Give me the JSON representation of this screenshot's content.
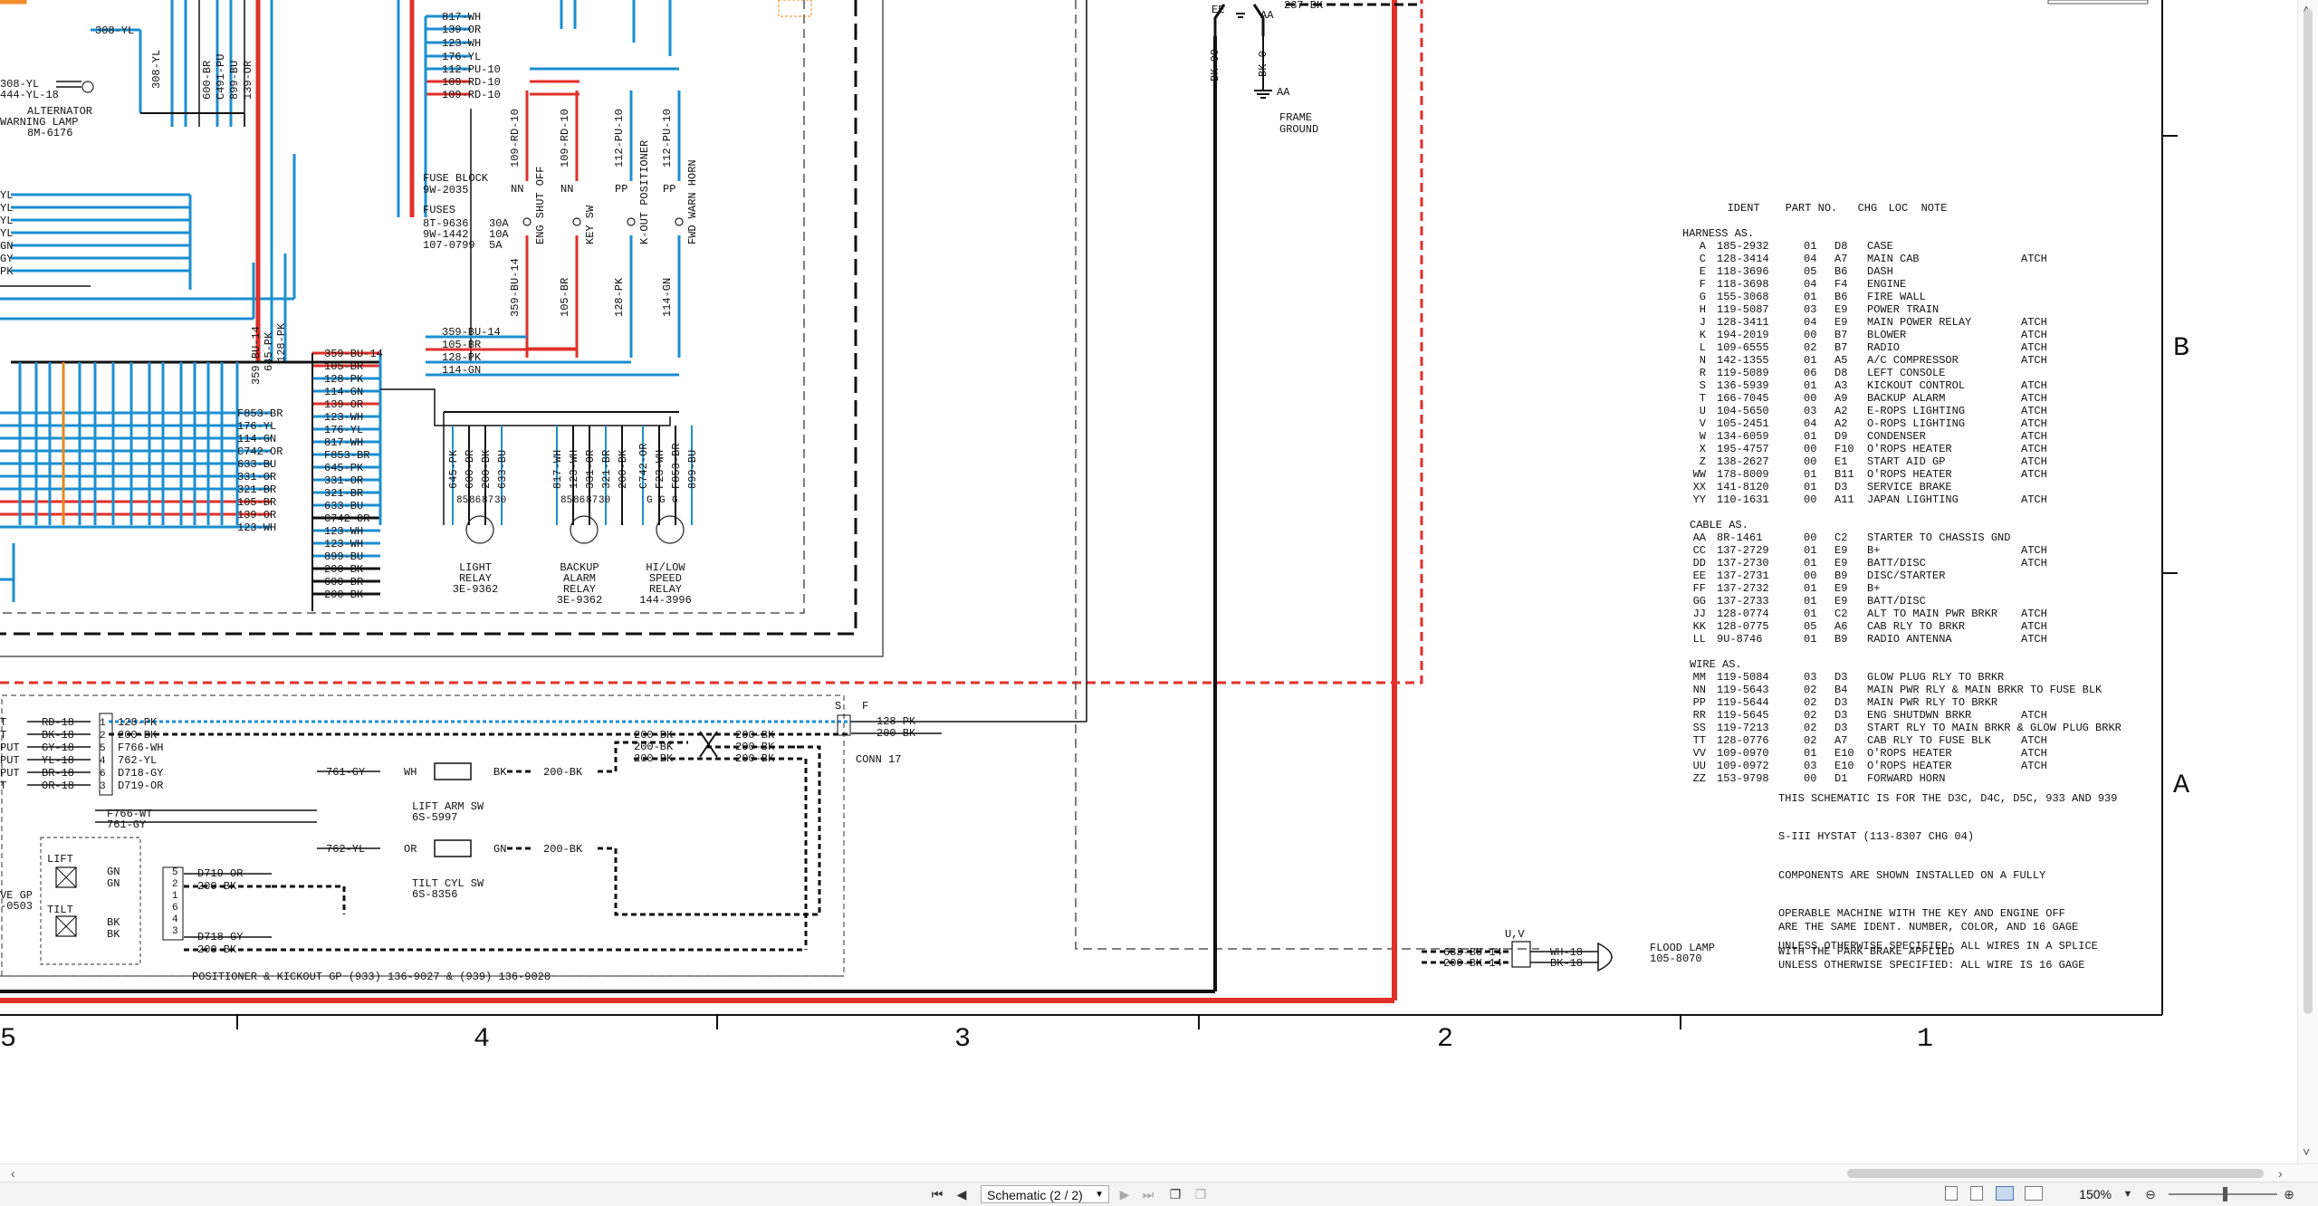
{
  "document": {
    "frame_letters": [
      "B",
      "A"
    ],
    "frame_numbers": [
      "5",
      "4",
      "3",
      "2",
      "1"
    ]
  },
  "left_harness": {
    "top_wire": "308-YL",
    "side_wires": [
      "YL",
      "YL",
      "YL",
      "YL",
      "GN",
      "GY",
      "PK"
    ],
    "alt_wires": [
      "308-YL",
      "444-YL-18"
    ],
    "alt_label": [
      "ALTERNATOR",
      "WARNING LAMP",
      "8M-6176"
    ],
    "vert_wires": [
      "308-YL",
      "600-BR",
      "C491-PU",
      "899-BU",
      "139-OR"
    ]
  },
  "fuse_block": {
    "title": [
      "FUSE BLOCK",
      "9W-2035"
    ],
    "fuses_title": "FUSES",
    "fuses": [
      {
        "part": "8T-9636",
        "amp": "30A"
      },
      {
        "part": "9W-1442",
        "amp": "10A"
      },
      {
        "part": "107-0799",
        "amp": "5A"
      }
    ],
    "top_wires": [
      "817-WH",
      "139-OR",
      "123-WH",
      "176-YL",
      "112-PU-10",
      "109-RD-10",
      "109-RD-10"
    ],
    "switches": [
      {
        "conn": "NN",
        "wire_top": "109-RD-10",
        "label": "ENG SHUT OFF",
        "wire_bottom": "359-BU-14"
      },
      {
        "conn": "NN",
        "wire_top": "109-RD-10",
        "label": "KEY SW",
        "wire_bottom": "105-BR"
      },
      {
        "conn": "PP",
        "wire_top": "112-PU-10",
        "label": "K-OUT POSITIONER",
        "wire_bottom": "128-PK"
      },
      {
        "conn": "PP",
        "wire_top": "112-PU-10",
        "label": "FWD WARN HORN",
        "wire_bottom": "114-GN"
      }
    ],
    "bottom_wires": [
      "359-BU-14",
      "105-BR",
      "128-PK",
      "114-GN"
    ]
  },
  "harness_mid": {
    "vert_labels": [
      "359-BU-14",
      "645-PK",
      "128-PK"
    ],
    "right_col": [
      "359-BU-14",
      "105-BR",
      "128-PK",
      "114-GN",
      "139-OR",
      "123-WH",
      "176-YL",
      "817-WH",
      "F853-BR",
      "645-PK",
      "331-OR",
      "321-BR",
      "633-BU",
      "C742-OR",
      "123-WH",
      "123-WH",
      "899-BU",
      "200-BK",
      "600-BR",
      "200-BK"
    ],
    "left_col": [
      "F853-BR",
      "176-YL",
      "114-GN",
      "C742-OR",
      "633-BU",
      "331-OR",
      "321-BR",
      "105-BR",
      "139-OR",
      "123-WH"
    ]
  },
  "relays": [
    {
      "wires": [
        "645-PK",
        "600-BR",
        "200-BK",
        "633-BU"
      ],
      "pins": [
        "85",
        "86",
        "87",
        "30"
      ],
      "label": [
        "LIGHT",
        "RELAY",
        "3E-9362"
      ]
    },
    {
      "wires": [
        "817-WH",
        "123-WH",
        "331-OR",
        "321-BR",
        "200-BK"
      ],
      "pins": [
        "85",
        "86",
        "87",
        "30"
      ],
      "label": [
        "BACKUP",
        "ALARM",
        "RELAY",
        "3E-9362"
      ]
    },
    {
      "wires": [
        "C742-OR",
        "F23-WH",
        "F853-BR",
        "899-BU"
      ],
      "pins": [
        "G",
        "G",
        "G"
      ],
      "label": [
        "HI/LOW",
        "SPEED",
        "RELAY",
        "144-3996"
      ]
    }
  ],
  "ground": {
    "wires": [
      "BK-00",
      "BK-0",
      "237-BK"
    ],
    "codes": [
      "EE",
      "AA",
      "AA"
    ],
    "label": [
      "FRAME",
      "GROUND"
    ]
  },
  "positioner": {
    "left_wires": [
      "RD-18",
      "BK-18",
      "GY-18",
      "YL-18",
      "BR-18",
      "OR-18"
    ],
    "left_stubs": [
      "T",
      "T",
      "PUT",
      "PUT",
      "PUT",
      "T"
    ],
    "pins_a": [
      "1",
      "2",
      "5",
      "4",
      "6",
      "3"
    ],
    "mid_wires": [
      "128-PK",
      "200-BK",
      "F766-WH",
      "762-YL",
      "D718-GY",
      "D719-OR"
    ],
    "loose": [
      "F766-WT",
      "761-GY"
    ],
    "lift_sw": {
      "wire_in": "761-GY",
      "color_a": "WH",
      "color_b": "BK",
      "wire_out": "200-BK",
      "label": [
        "LIFT ARM SW",
        "6S-5997"
      ]
    },
    "tilt_sw": {
      "wire_in": "762-YL",
      "color_a": "OR",
      "color_b": "GN",
      "wire_out": "200-BK",
      "label": [
        "TILT CYL SW",
        "6S-8356"
      ]
    },
    "splice_left": [
      "200-BK",
      "200-BK",
      "200-BK"
    ],
    "splice_right": [
      "200-BK",
      "200-BK",
      "200-BK"
    ],
    "conn17": {
      "wires": [
        "128-PK",
        "200-BK"
      ],
      "label": "CONN 17",
      "codes": [
        "S",
        "F"
      ]
    },
    "valve": {
      "parts": [
        "LIFT",
        "TILT"
      ],
      "colors": [
        "GN",
        "GN",
        "BK",
        "BK"
      ],
      "pins": [
        "5",
        "2",
        "1",
        "6",
        "4",
        "3"
      ],
      "wires": [
        "D719-OR",
        "200-BK",
        "D718-GY",
        "200-BK"
      ],
      "left_text": [
        "VE GP",
        "-0503"
      ]
    },
    "footer": "POSITIONER & KICKOUT GP (933) 136-9027 & (939) 136-9028"
  },
  "flood_lamp": {
    "codes": "U,V",
    "wires_left": [
      "633-BU-14",
      "200-BK-14"
    ],
    "wires_right": [
      "WH-18",
      "BK-18"
    ],
    "label": [
      "FLOOD LAMP",
      "105-8070"
    ]
  },
  "ident_table": {
    "header": {
      "ident": "IDENT",
      "part": "PART NO.",
      "chg": "CHG",
      "loc": "LOC",
      "note": "NOTE"
    },
    "sections": [
      {
        "title": "HARNESS AS.",
        "rows": [
          {
            "id": "A",
            "part": "185-2932",
            "chg": "01",
            "loc": "D8",
            "desc": "CASE",
            "att": ""
          },
          {
            "id": "C",
            "part": "128-3414",
            "chg": "04",
            "loc": "A7",
            "desc": "MAIN CAB",
            "att": "ATCH"
          },
          {
            "id": "E",
            "part": "118-3696",
            "chg": "05",
            "loc": "B6",
            "desc": "DASH",
            "att": ""
          },
          {
            "id": "F",
            "part": "118-3698",
            "chg": "04",
            "loc": "F4",
            "desc": "ENGINE",
            "att": ""
          },
          {
            "id": "G",
            "part": "155-3068",
            "chg": "01",
            "loc": "B6",
            "desc": "FIRE WALL",
            "att": ""
          },
          {
            "id": "H",
            "part": "119-5087",
            "chg": "03",
            "loc": "E9",
            "desc": "POWER TRAIN",
            "att": ""
          },
          {
            "id": "J",
            "part": "128-3411",
            "chg": "04",
            "loc": "E9",
            "desc": "MAIN POWER RELAY",
            "att": "ATCH"
          },
          {
            "id": "K",
            "part": "194-2019",
            "chg": "00",
            "loc": "B7",
            "desc": "BLOWER",
            "att": "ATCH"
          },
          {
            "id": "L",
            "part": "109-6555",
            "chg": "02",
            "loc": "B7",
            "desc": "RADIO",
            "att": "ATCH"
          },
          {
            "id": "N",
            "part": "142-1355",
            "chg": "01",
            "loc": "A5",
            "desc": "A/C COMPRESSOR",
            "att": "ATCH"
          },
          {
            "id": "R",
            "part": "119-5089",
            "chg": "06",
            "loc": "D8",
            "desc": "LEFT CONSOLE",
            "att": ""
          },
          {
            "id": "S",
            "part": "136-5939",
            "chg": "01",
            "loc": "A3",
            "desc": "KICKOUT CONTROL",
            "att": "ATCH"
          },
          {
            "id": "T",
            "part": "166-7045",
            "chg": "00",
            "loc": "A9",
            "desc": "BACKUP ALARM",
            "att": "ATCH"
          },
          {
            "id": "U",
            "part": "104-5650",
            "chg": "03",
            "loc": "A2",
            "desc": "E-ROPS LIGHTING",
            "att": "ATCH"
          },
          {
            "id": "V",
            "part": "105-2451",
            "chg": "04",
            "loc": "A2",
            "desc": "O-ROPS LIGHTING",
            "att": "ATCH"
          },
          {
            "id": "W",
            "part": "134-6059",
            "chg": "01",
            "loc": "D9",
            "desc": "CONDENSER",
            "att": "ATCH"
          },
          {
            "id": "X",
            "part": "195-4757",
            "chg": "00",
            "loc": "F10",
            "desc": "O'ROPS HEATER",
            "att": "ATCH"
          },
          {
            "id": "Z",
            "part": "138-2627",
            "chg": "00",
            "loc": "E1",
            "desc": "START AID GP",
            "att": "ATCH"
          },
          {
            "id": "WW",
            "part": "178-8009",
            "chg": "01",
            "loc": "B11",
            "desc": "O'ROPS HEATER",
            "att": "ATCH"
          },
          {
            "id": "XX",
            "part": "141-8120",
            "chg": "01",
            "loc": "D3",
            "desc": "SERVICE BRAKE",
            "att": ""
          },
          {
            "id": "YY",
            "part": "110-1631",
            "chg": "00",
            "loc": "A11",
            "desc": "JAPAN LIGHTING",
            "att": "ATCH"
          }
        ]
      },
      {
        "title": "CABLE AS.",
        "rows": [
          {
            "id": "AA",
            "part": "8R-1461",
            "chg": "00",
            "loc": "C2",
            "desc": "STARTER TO CHASSIS GND",
            "att": ""
          },
          {
            "id": "CC",
            "part": "137-2729",
            "chg": "01",
            "loc": "E9",
            "desc": "B+",
            "att": "ATCH"
          },
          {
            "id": "DD",
            "part": "137-2730",
            "chg": "01",
            "loc": "E9",
            "desc": "BATT/DISC",
            "att": "ATCH"
          },
          {
            "id": "EE",
            "part": "137-2731",
            "chg": "00",
            "loc": "B9",
            "desc": "DISC/STARTER",
            "att": ""
          },
          {
            "id": "FF",
            "part": "137-2732",
            "chg": "01",
            "loc": "E9",
            "desc": "B+",
            "att": ""
          },
          {
            "id": "GG",
            "part": "137-2733",
            "chg": "01",
            "loc": "E9",
            "desc": "BATT/DISC",
            "att": ""
          },
          {
            "id": "JJ",
            "part": "128-0774",
            "chg": "01",
            "loc": "C2",
            "desc": "ALT TO MAIN PWR BRKR",
            "att": "ATCH"
          },
          {
            "id": "KK",
            "part": "128-0775",
            "chg": "05",
            "loc": "A6",
            "desc": "CAB RLY TO BRKR",
            "att": "ATCH"
          },
          {
            "id": "LL",
            "part": "9U-8746",
            "chg": "01",
            "loc": "B9",
            "desc": "RADIO ANTENNA",
            "att": "ATCH"
          }
        ]
      },
      {
        "title": "WIRE AS.",
        "rows": [
          {
            "id": "MM",
            "part": "119-5084",
            "chg": "03",
            "loc": "D3",
            "desc": "GLOW PLUG RLY TO BRKR",
            "att": ""
          },
          {
            "id": "NN",
            "part": "119-5643",
            "chg": "02",
            "loc": "B4",
            "desc": "MAIN PWR RLY & MAIN BRKR TO FUSE BLK",
            "att": ""
          },
          {
            "id": "PP",
            "part": "119-5644",
            "chg": "02",
            "loc": "D3",
            "desc": "MAIN PWR RLY TO BRKR",
            "att": ""
          },
          {
            "id": "RR",
            "part": "119-5645",
            "chg": "02",
            "loc": "D3",
            "desc": "ENG SHUTDWN BRKR",
            "att": "ATCH"
          },
          {
            "id": "SS",
            "part": "119-7213",
            "chg": "02",
            "loc": "D3",
            "desc": "START RLY TO MAIN BRKR & GLOW PLUG BRKR",
            "att": ""
          },
          {
            "id": "TT",
            "part": "128-0776",
            "chg": "02",
            "loc": "A7",
            "desc": "CAB RLY TO FUSE BLK",
            "att": "ATCH"
          },
          {
            "id": "VV",
            "part": "109-0970",
            "chg": "01",
            "loc": "E10",
            "desc": "O'ROPS HEATER",
            "att": "ATCH"
          },
          {
            "id": "UU",
            "part": "109-0972",
            "chg": "03",
            "loc": "E10",
            "desc": "O'ROPS HEATER",
            "att": "ATCH"
          },
          {
            "id": "ZZ",
            "part": "153-9798",
            "chg": "00",
            "loc": "D1",
            "desc": "FORWARD HORN",
            "att": ""
          }
        ]
      }
    ]
  },
  "notes": {
    "applies": [
      "THIS SCHEMATIC IS FOR THE D3C, D4C, D5C, 933 AND 939",
      "S-III HYSTAT (113-8307 CHG 04)"
    ],
    "components": [
      "COMPONENTS ARE SHOWN INSTALLED ON A FULLY",
      "OPERABLE MACHINE WITH THE KEY AND ENGINE OFF",
      "WITH THE PARK BRAKE APPLIED"
    ],
    "same_ident": "ARE THE SAME IDENT. NUMBER, COLOR, AND 16 GAGE",
    "splice": "UNLESS OTHERWISE SPECIFIED: ALL WIRES IN A SPLICE",
    "gage": "UNLESS OTHERWISE SPECIFIED: ALL WIRE IS 16 GAGE"
  },
  "statusbar": {
    "page_select": "Schematic (2 / 2)",
    "zoom": "150%",
    "nav_icons": [
      "first-page-icon",
      "prev-page-icon",
      "next-page-icon",
      "last-page-icon"
    ],
    "view_icons": [
      "single-page-icon",
      "continuous-icon",
      "two-page-icon",
      "two-page-continuous-icon"
    ]
  },
  "colors": {
    "wire_blue": "#1b8fd1",
    "wire_red": "#e0302a",
    "wire_orange": "#e08a1e",
    "wire_black": "#111111",
    "accent_orange": "#f28c28"
  }
}
